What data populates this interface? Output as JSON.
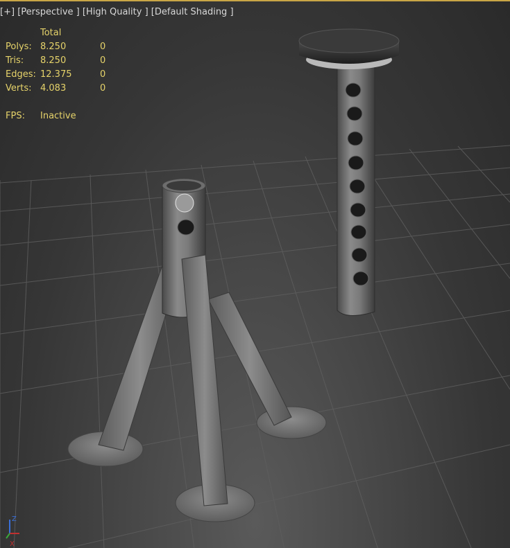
{
  "viewport": {
    "menu_plus": "[+]",
    "menu_view": "[Perspective ]",
    "menu_quality": "[High Quality ]",
    "menu_shading": "[Default Shading ]"
  },
  "stats": {
    "column_header": "Total",
    "rows": [
      {
        "label": "Polys:",
        "total": "8.250",
        "selected": "0"
      },
      {
        "label": "Tris:",
        "total": "8.250",
        "selected": "0"
      },
      {
        "label": "Edges:",
        "total": "12.375",
        "selected": "0"
      },
      {
        "label": "Verts:",
        "total": "4.083",
        "selected": "0"
      }
    ],
    "fps_label": "FPS:",
    "fps_value": "Inactive"
  },
  "gizmo": {
    "z_label": "Z",
    "x_label": "X"
  },
  "colors": {
    "accent": "#c9a646",
    "stats_text": "#e6d36a",
    "grid": "#5e5e5e"
  }
}
